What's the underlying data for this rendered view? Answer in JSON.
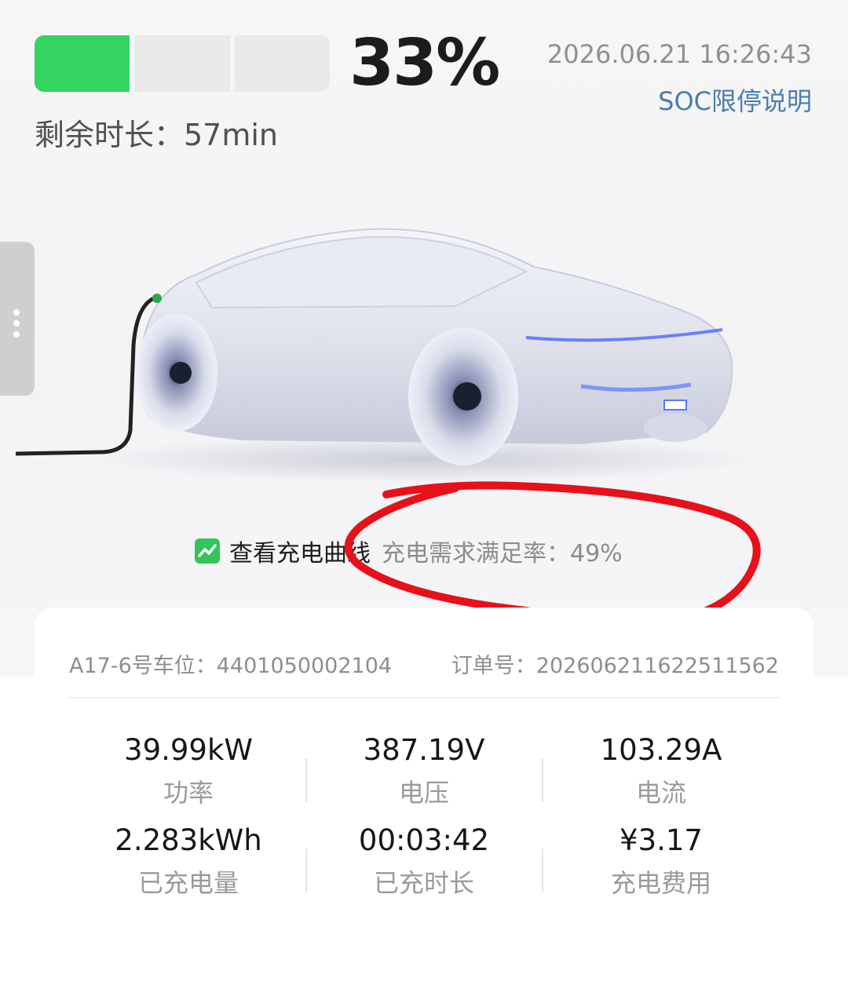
{
  "battery": {
    "segments_total": 3,
    "segments_filled": 1,
    "percent": "33%"
  },
  "remaining_time": "剩余时长：57min",
  "timestamp": "2026.06.21 16:26:43",
  "soc_link": "SOC限停说明",
  "curve_link": "查看充电曲线",
  "demand_rate": "充电需求满足率：49%",
  "order": {
    "parking_spot": "A17-6号车位：4401050002104",
    "order_number": "订单号：20260621162251​1562"
  },
  "stats": [
    {
      "value": "39.99kW",
      "label": "功率"
    },
    {
      "value": "387.19V",
      "label": "电压"
    },
    {
      "value": "103.29A",
      "label": "电流"
    },
    {
      "value": "2.283kWh",
      "label": "已充电量"
    },
    {
      "value": "00:03:42",
      "label": "已充时长"
    },
    {
      "value": "¥3.17",
      "label": "充电费用"
    }
  ],
  "colors": {
    "battery_fill": "#33d460",
    "link": "#4a7cae",
    "annotation": "#e8101a"
  }
}
